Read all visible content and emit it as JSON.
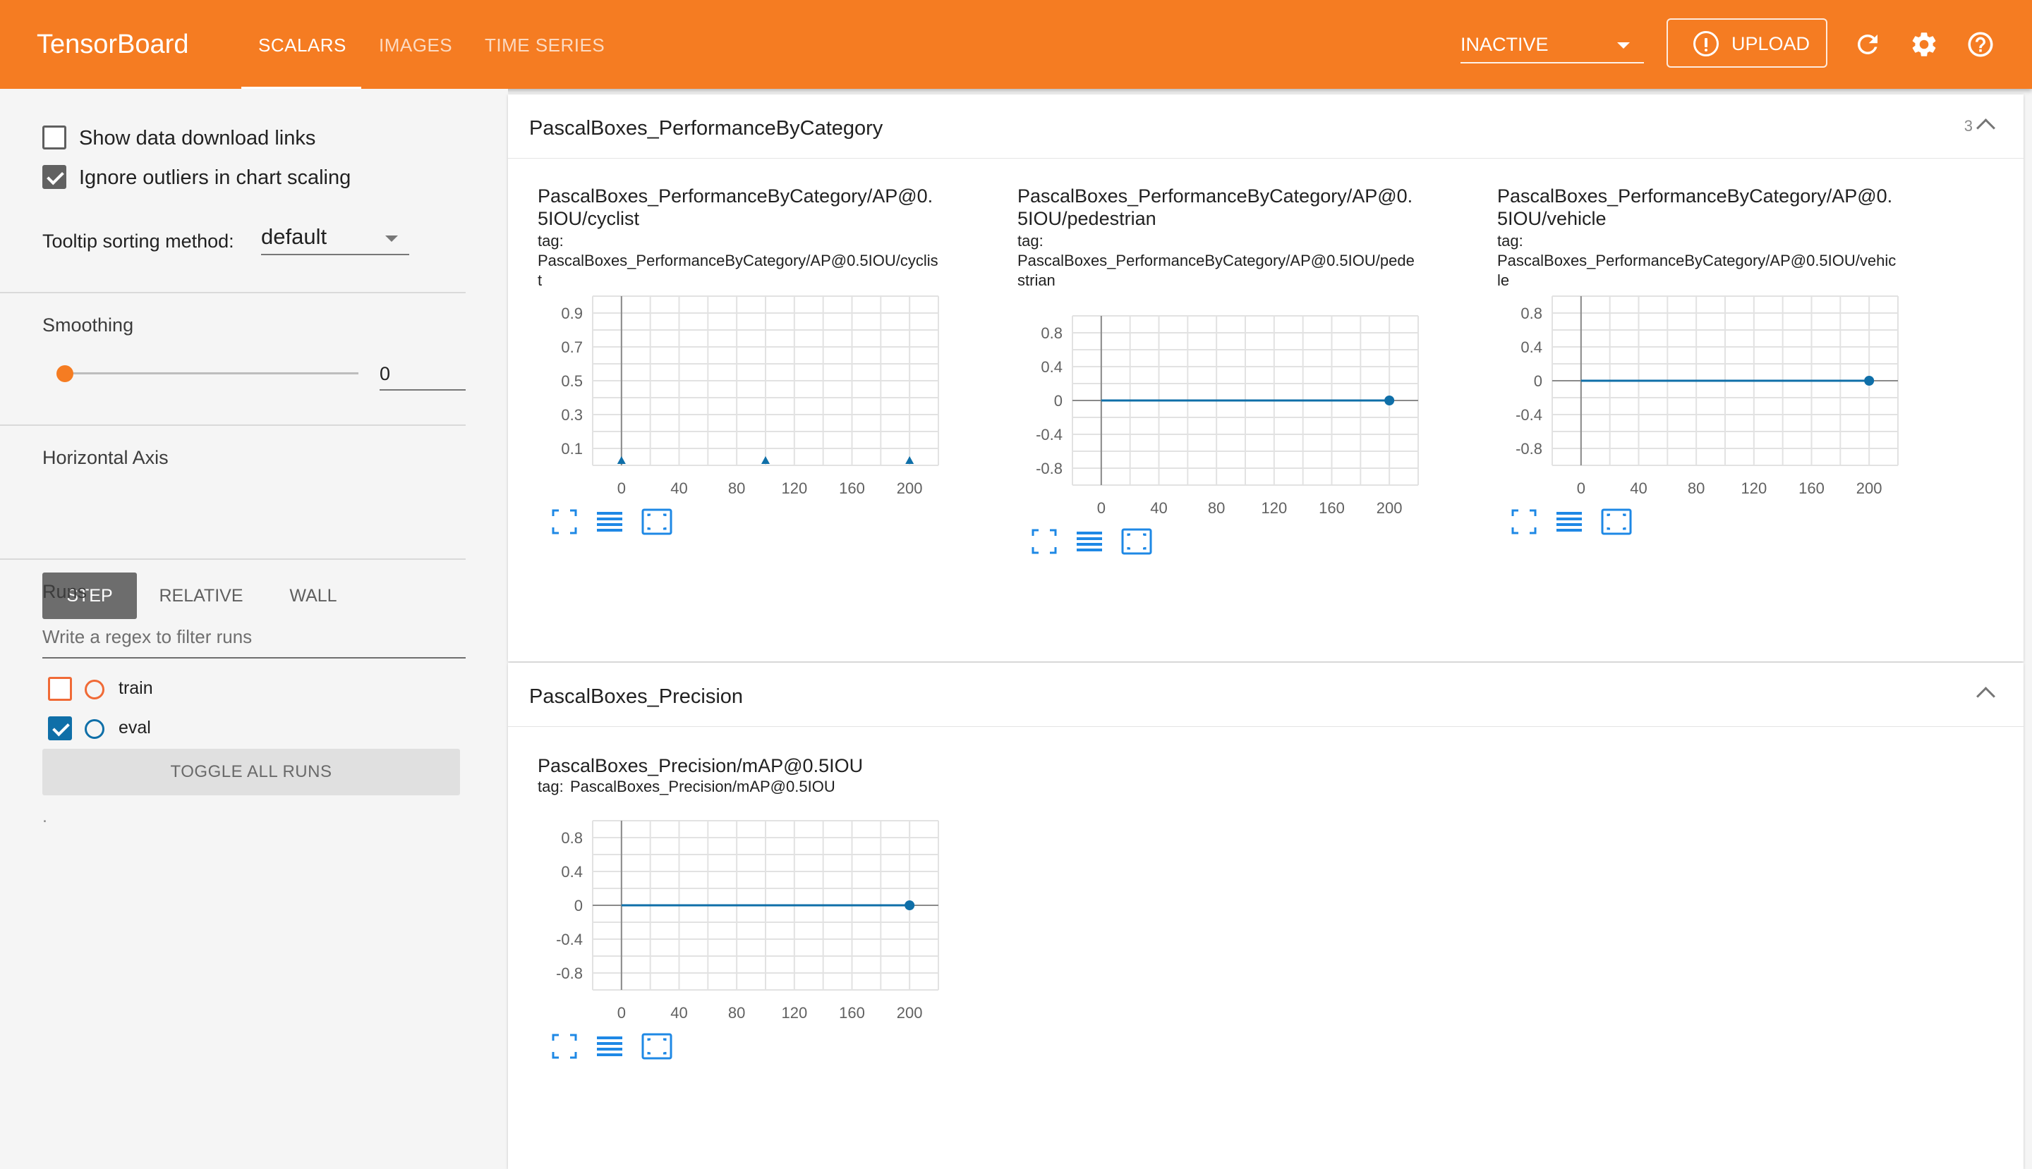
{
  "header": {
    "brand": "TensorBoard",
    "tabs": [
      {
        "label": "SCALARS",
        "active": true
      },
      {
        "label": "IMAGES",
        "active": false
      },
      {
        "label": "TIME SERIES",
        "active": false
      }
    ],
    "status_select": "INACTIVE",
    "upload_label": "UPLOAD",
    "icons": [
      "info-icon",
      "refresh-icon",
      "gear-icon",
      "help-icon"
    ],
    "color": "#f57c22"
  },
  "sidebar": {
    "show_download_links": {
      "label": "Show data download links",
      "checked": false
    },
    "ignore_outliers": {
      "label": "Ignore outliers in chart scaling",
      "checked": true
    },
    "tooltip_sorting": {
      "label": "Tooltip sorting method:",
      "value": "default"
    },
    "smoothing": {
      "title": "Smoothing",
      "value": "0",
      "fraction": 0
    },
    "horizontal_axis": {
      "title": "Horizontal Axis",
      "options": [
        "STEP",
        "RELATIVE",
        "WALL"
      ],
      "selected": "STEP"
    },
    "runs": {
      "title": "Runs",
      "filter_placeholder": "Write a regex to filter runs",
      "items": [
        {
          "label": "train",
          "checked": false,
          "color": "#f06a36"
        },
        {
          "label": "eval",
          "checked": true,
          "color": "#0f6fa8"
        }
      ],
      "toggle_all": "TOGGLE ALL RUNS",
      "footer_dot": "."
    }
  },
  "groups": [
    {
      "title": "PascalBoxes_PerformanceByCategory",
      "count": "3",
      "charts": [
        {
          "title": "PascalBoxes_PerformanceByCategory/AP@0.5IOU/cyclist",
          "tag_label": "tag:",
          "tag": "PascalBoxes_PerformanceByCategory/AP@0.5IOU/cyclist"
        },
        {
          "title": "PascalBoxes_PerformanceByCategory/AP@0.5IOU/pedestrian",
          "tag_label": "tag:",
          "tag": "PascalBoxes_PerformanceByCategory/AP@0.5IOU/pedestrian"
        },
        {
          "title": "PascalBoxes_PerformanceByCategory/AP@0.5IOU/vehicle",
          "tag_label": "tag:",
          "tag": "PascalBoxes_PerformanceByCategory/AP@0.5IOU/vehicle"
        }
      ]
    },
    {
      "title": "PascalBoxes_Precision",
      "charts": [
        {
          "title": "PascalBoxes_Precision/mAP@0.5IOU",
          "tag_label": "tag:",
          "tag": "PascalBoxes_Precision/mAP@0.5IOU"
        }
      ]
    }
  ],
  "chart_data": [
    {
      "type": "scatter",
      "title": "PascalBoxes_PerformanceByCategory/AP@0.5IOU/cyclist",
      "xlim": [
        -20,
        220
      ],
      "ylim": [
        0,
        1.0
      ],
      "xticks": [
        0,
        40,
        80,
        120,
        160,
        200
      ],
      "yticks": [
        0.1,
        0.3,
        0.5,
        0.7,
        0.9
      ],
      "ytick_labels": [
        "0.1",
        "0.3",
        "0.5",
        "0.7",
        "0.9"
      ],
      "grid": true,
      "series": [
        {
          "x": [
            0,
            100,
            200
          ],
          "y": [
            0,
            0,
            0
          ],
          "color": "#0f6fa8",
          "marker": "triangle"
        }
      ]
    },
    {
      "type": "line",
      "title": "PascalBoxes_PerformanceByCategory/AP@0.5IOU/pedestrian",
      "xlim": [
        -20,
        220
      ],
      "ylim": [
        -1.0,
        1.0
      ],
      "xticks": [
        0,
        40,
        80,
        120,
        160,
        200
      ],
      "yticks": [
        -0.8,
        -0.4,
        0,
        0.4,
        0.8
      ],
      "ytick_labels": [
        "-0.8",
        "-0.4",
        "0",
        "0.4",
        "0.8"
      ],
      "grid": true,
      "series": [
        {
          "x": [
            0,
            200
          ],
          "y": [
            0,
            0
          ],
          "color": "#0f6fa8"
        }
      ]
    },
    {
      "type": "line",
      "title": "PascalBoxes_PerformanceByCategory/AP@0.5IOU/vehicle",
      "xlim": [
        -20,
        220
      ],
      "ylim": [
        -1.0,
        1.0
      ],
      "xticks": [
        0,
        40,
        80,
        120,
        160,
        200
      ],
      "yticks": [
        -0.8,
        -0.4,
        0,
        0.4,
        0.8
      ],
      "ytick_labels": [
        "-0.8",
        "-0.4",
        "0",
        "0.4",
        "0.8"
      ],
      "grid": true,
      "series": [
        {
          "x": [
            0,
            200
          ],
          "y": [
            0,
            0
          ],
          "color": "#0f6fa8"
        }
      ]
    },
    {
      "type": "line",
      "title": "PascalBoxes_Precision/mAP@0.5IOU",
      "xlim": [
        -20,
        220
      ],
      "ylim": [
        -1.0,
        1.0
      ],
      "xticks": [
        0,
        40,
        80,
        120,
        160,
        200
      ],
      "yticks": [
        -0.8,
        -0.4,
        0,
        0.4,
        0.8
      ],
      "ytick_labels": [
        "-0.8",
        "-0.4",
        "0",
        "0.4",
        "0.8"
      ],
      "grid": true,
      "series": [
        {
          "x": [
            0,
            200
          ],
          "y": [
            0,
            0
          ],
          "color": "#0f6fa8"
        }
      ]
    }
  ]
}
